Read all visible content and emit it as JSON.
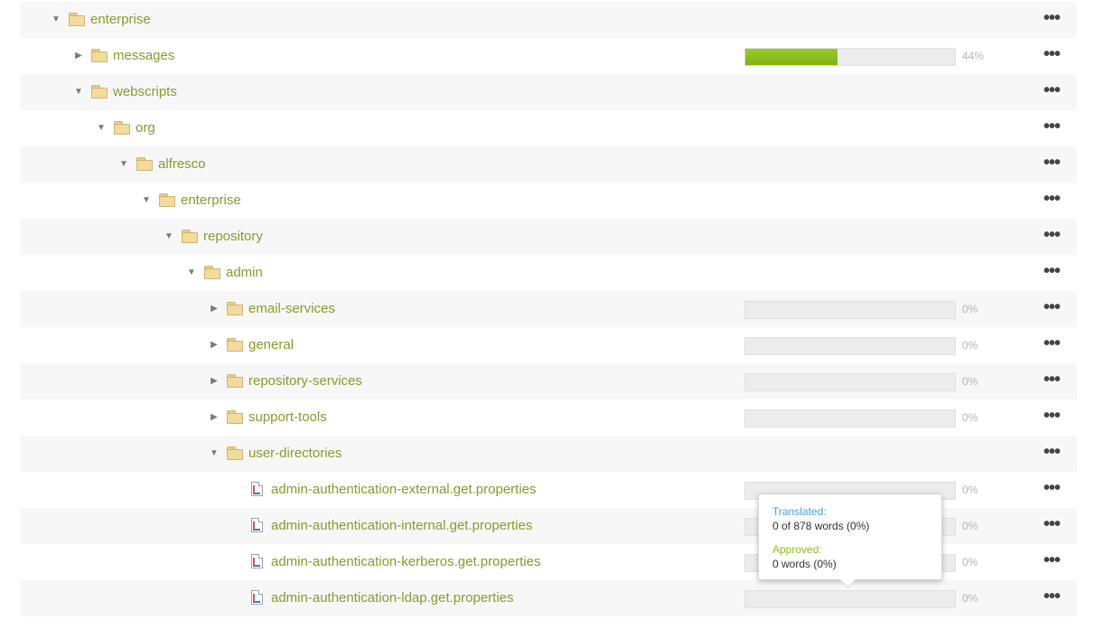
{
  "tree": [
    {
      "label": "enterprise",
      "type": "folder",
      "depth": 0,
      "toggle": "expanded",
      "progress": null,
      "percent_label": ""
    },
    {
      "label": "messages",
      "type": "folder",
      "depth": 1,
      "toggle": "collapsed",
      "progress": 44,
      "percent_label": "44%"
    },
    {
      "label": "webscripts",
      "type": "folder",
      "depth": 1,
      "toggle": "expanded",
      "progress": null,
      "percent_label": ""
    },
    {
      "label": "org",
      "type": "folder",
      "depth": 2,
      "toggle": "expanded",
      "progress": null,
      "percent_label": ""
    },
    {
      "label": "alfresco",
      "type": "folder",
      "depth": 3,
      "toggle": "expanded",
      "progress": null,
      "percent_label": ""
    },
    {
      "label": "enterprise",
      "type": "folder",
      "depth": 4,
      "toggle": "expanded",
      "progress": null,
      "percent_label": ""
    },
    {
      "label": "repository",
      "type": "folder",
      "depth": 5,
      "toggle": "expanded",
      "progress": null,
      "percent_label": ""
    },
    {
      "label": "admin",
      "type": "folder",
      "depth": 6,
      "toggle": "expanded",
      "progress": null,
      "percent_label": ""
    },
    {
      "label": "email-services",
      "type": "folder",
      "depth": 7,
      "toggle": "collapsed",
      "progress": 0,
      "percent_label": "0%"
    },
    {
      "label": "general",
      "type": "folder",
      "depth": 7,
      "toggle": "collapsed",
      "progress": 0,
      "percent_label": "0%"
    },
    {
      "label": "repository-services",
      "type": "folder",
      "depth": 7,
      "toggle": "collapsed",
      "progress": 0,
      "percent_label": "0%"
    },
    {
      "label": "support-tools",
      "type": "folder",
      "depth": 7,
      "toggle": "collapsed",
      "progress": 0,
      "percent_label": "0%"
    },
    {
      "label": "user-directories",
      "type": "folder",
      "depth": 7,
      "toggle": "expanded",
      "progress": null,
      "percent_label": ""
    },
    {
      "label": "admin-authentication-external.get.properties",
      "type": "file",
      "depth": 8,
      "toggle": "none",
      "progress": 0,
      "percent_label": "0%"
    },
    {
      "label": "admin-authentication-internal.get.properties",
      "type": "file",
      "depth": 8,
      "toggle": "none",
      "progress": 0,
      "percent_label": "0%"
    },
    {
      "label": "admin-authentication-kerberos.get.properties",
      "type": "file",
      "depth": 8,
      "toggle": "none",
      "progress": 0,
      "percent_label": "0%"
    },
    {
      "label": "admin-authentication-ldap.get.properties",
      "type": "file",
      "depth": 8,
      "toggle": "none",
      "progress": 0,
      "percent_label": "0%"
    }
  ],
  "row_menu_label": "•••",
  "tooltip": {
    "translated_title": "Translated:",
    "translated_value": "0 of 878 words (0%)",
    "approved_title": "Approved:",
    "approved_value": "0 words (0%)"
  },
  "colors": {
    "label": "#8a9a2e",
    "progress_fill": "#8cc01f",
    "progress_track": "#ececec",
    "translated_title": "#4a9fd6",
    "approved_title": "#8fbc2a"
  },
  "icons": {
    "folder": "folder-icon",
    "file": "properties-file-icon",
    "expanded": "triangle-down-icon",
    "collapsed": "triangle-right-icon",
    "menu": "more-dots-icon"
  }
}
